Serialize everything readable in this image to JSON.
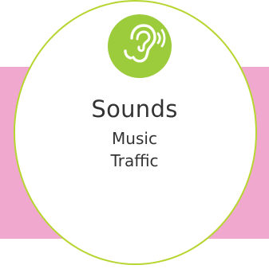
{
  "colors": {
    "pink_band": "#f0a8cf",
    "circle_border": "#b7d531",
    "icon_badge": "#9ccb3b",
    "text": "#333333"
  },
  "icon": "ear-sound-icon",
  "card": {
    "title": "Sounds",
    "items": [
      "Music",
      "Traffic"
    ]
  }
}
